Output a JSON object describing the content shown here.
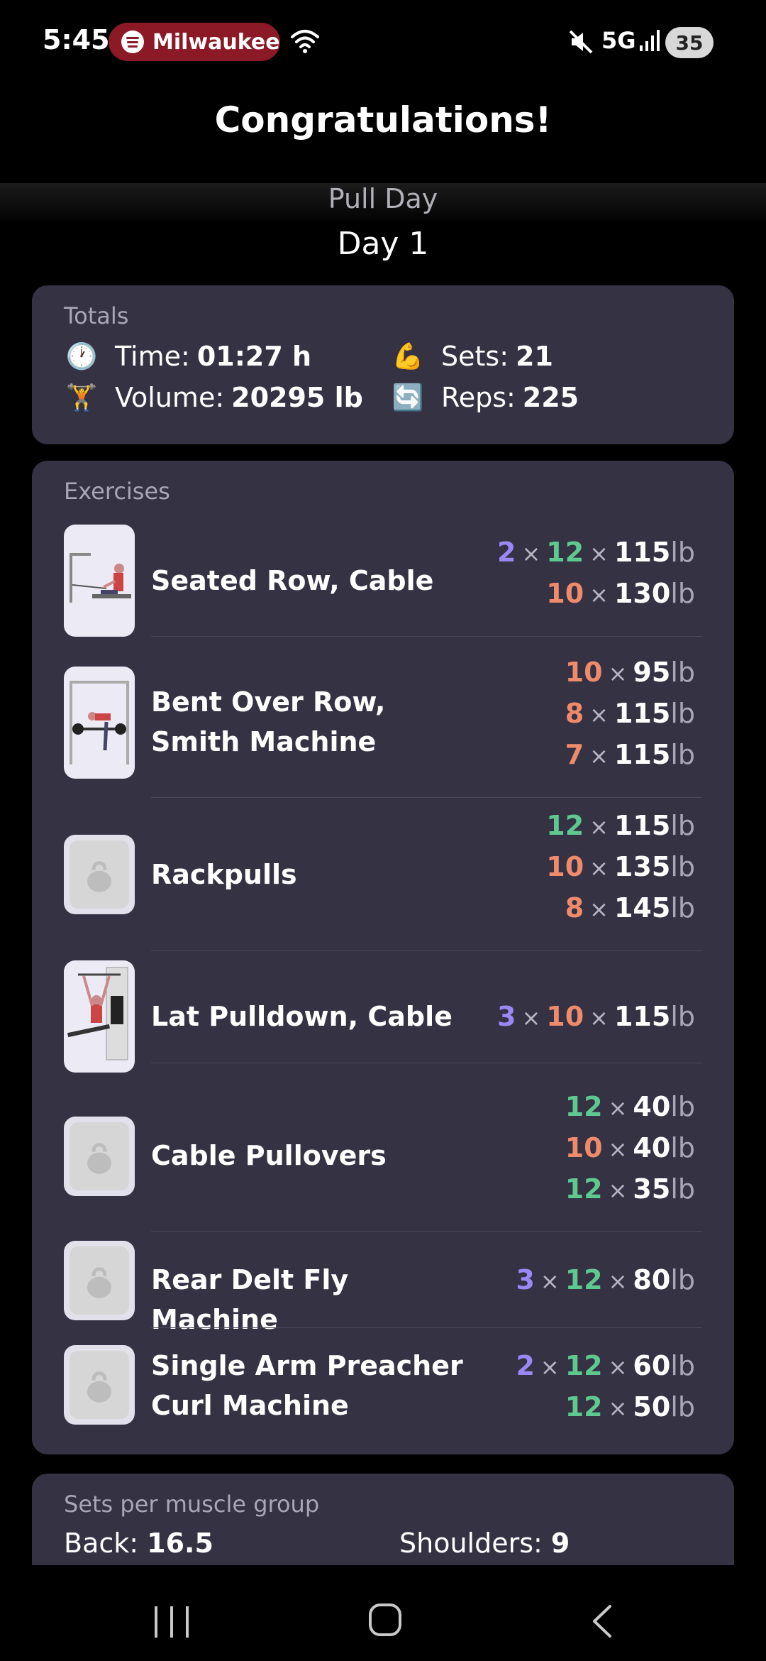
{
  "status_bar": {
    "time": "5:45",
    "spotify_label": "Milwaukee",
    "network": "5G",
    "battery": "35"
  },
  "header": {
    "title": "Congratulations!",
    "workout_name": "Pull Day",
    "day_label": "Day 1"
  },
  "totals": {
    "title": "Totals",
    "time_label": "Time:",
    "time_value": "01:27 h",
    "sets_label": "Sets:",
    "sets_value": "21",
    "volume_label": "Volume:",
    "volume_value": "20295 lb",
    "reps_label": "Reps:",
    "reps_value": "225",
    "icons": [
      "clock-icon",
      "flexed-biceps-icon",
      "weightlifter-icon",
      "repeat-icon"
    ]
  },
  "exercises": {
    "title": "Exercises",
    "multiply": "×",
    "unit": "lb",
    "colors": {
      "purple": "#9b87f5",
      "green": "#5ec98f",
      "orange": "#ef8a6a"
    },
    "items": [
      {
        "name": "Seated Row, Cable",
        "thumbnail": "seated-row-illustration",
        "sets": [
          {
            "count": "2",
            "reps": "12",
            "weight": "115"
          },
          {
            "reps": "10",
            "weight": "130"
          }
        ]
      },
      {
        "name": "Bent Over Row, Smith Machine",
        "thumbnail": "smith-row-illustration",
        "sets": [
          {
            "reps": "10",
            "weight": "95"
          },
          {
            "reps": "8",
            "weight": "115"
          },
          {
            "reps": "7",
            "weight": "115"
          }
        ]
      },
      {
        "name": "Rackpulls",
        "thumbnail": "kettlebell-placeholder-icon",
        "sets": [
          {
            "reps": "12",
            "weight": "115"
          },
          {
            "reps": "10",
            "weight": "135"
          },
          {
            "reps": "8",
            "weight": "145"
          }
        ]
      },
      {
        "name": "Lat Pulldown, Cable",
        "thumbnail": "lat-pulldown-illustration",
        "sets": [
          {
            "count": "3",
            "reps": "10",
            "weight": "115"
          }
        ]
      },
      {
        "name": "Cable Pullovers",
        "thumbnail": "kettlebell-placeholder-icon",
        "sets": [
          {
            "reps": "12",
            "weight": "40"
          },
          {
            "reps": "10",
            "weight": "40"
          },
          {
            "reps": "12",
            "weight": "35"
          }
        ]
      },
      {
        "name": "Rear Delt Fly Machine",
        "thumbnail": "kettlebell-placeholder-icon",
        "sets": [
          {
            "count": "3",
            "reps": "12",
            "weight": "80"
          }
        ]
      },
      {
        "name": "Single Arm Preacher Curl Machine",
        "thumbnail": "kettlebell-placeholder-icon",
        "sets": [
          {
            "count": "2",
            "reps": "12",
            "weight": "60"
          },
          {
            "reps": "12",
            "weight": "50"
          }
        ]
      }
    ]
  },
  "muscle_groups": {
    "title": "Sets per muscle group",
    "back_label": "Back:",
    "back_value": "16.5",
    "shoulders_label": "Shoulders:",
    "shoulders_value": "9"
  }
}
